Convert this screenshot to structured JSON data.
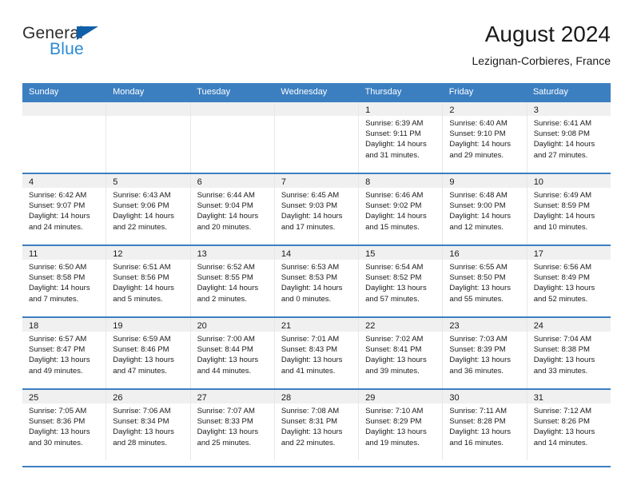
{
  "brand": {
    "name_part1": "General",
    "name_part2": "Blue",
    "triangle_icon": "blue-triangle-icon",
    "colors": {
      "dark": "#2e2e2e",
      "blue": "#2a8ad4",
      "triangle": "#1060a8"
    }
  },
  "header": {
    "title": "August 2024",
    "subtitle": "Lezignan-Corbieres, France"
  },
  "theme": {
    "header_bg": "#3c7fc1",
    "header_text": "#ffffff",
    "daynum_band": "#f0f0f0",
    "row_separator": "#3c7fc1",
    "column_separator": "#e7e7e7"
  },
  "weekday_headers": [
    "Sunday",
    "Monday",
    "Tuesday",
    "Wednesday",
    "Thursday",
    "Friday",
    "Saturday"
  ],
  "weeks": [
    [
      {
        "day": "",
        "sunrise": "",
        "sunset": "",
        "daylight_a": "",
        "daylight_b": ""
      },
      {
        "day": "",
        "sunrise": "",
        "sunset": "",
        "daylight_a": "",
        "daylight_b": ""
      },
      {
        "day": "",
        "sunrise": "",
        "sunset": "",
        "daylight_a": "",
        "daylight_b": ""
      },
      {
        "day": "",
        "sunrise": "",
        "sunset": "",
        "daylight_a": "",
        "daylight_b": ""
      },
      {
        "day": "1",
        "sunrise": "Sunrise: 6:39 AM",
        "sunset": "Sunset: 9:11 PM",
        "daylight_a": "Daylight: 14 hours",
        "daylight_b": "and 31 minutes."
      },
      {
        "day": "2",
        "sunrise": "Sunrise: 6:40 AM",
        "sunset": "Sunset: 9:10 PM",
        "daylight_a": "Daylight: 14 hours",
        "daylight_b": "and 29 minutes."
      },
      {
        "day": "3",
        "sunrise": "Sunrise: 6:41 AM",
        "sunset": "Sunset: 9:08 PM",
        "daylight_a": "Daylight: 14 hours",
        "daylight_b": "and 27 minutes."
      }
    ],
    [
      {
        "day": "4",
        "sunrise": "Sunrise: 6:42 AM",
        "sunset": "Sunset: 9:07 PM",
        "daylight_a": "Daylight: 14 hours",
        "daylight_b": "and 24 minutes."
      },
      {
        "day": "5",
        "sunrise": "Sunrise: 6:43 AM",
        "sunset": "Sunset: 9:06 PM",
        "daylight_a": "Daylight: 14 hours",
        "daylight_b": "and 22 minutes."
      },
      {
        "day": "6",
        "sunrise": "Sunrise: 6:44 AM",
        "sunset": "Sunset: 9:04 PM",
        "daylight_a": "Daylight: 14 hours",
        "daylight_b": "and 20 minutes."
      },
      {
        "day": "7",
        "sunrise": "Sunrise: 6:45 AM",
        "sunset": "Sunset: 9:03 PM",
        "daylight_a": "Daylight: 14 hours",
        "daylight_b": "and 17 minutes."
      },
      {
        "day": "8",
        "sunrise": "Sunrise: 6:46 AM",
        "sunset": "Sunset: 9:02 PM",
        "daylight_a": "Daylight: 14 hours",
        "daylight_b": "and 15 minutes."
      },
      {
        "day": "9",
        "sunrise": "Sunrise: 6:48 AM",
        "sunset": "Sunset: 9:00 PM",
        "daylight_a": "Daylight: 14 hours",
        "daylight_b": "and 12 minutes."
      },
      {
        "day": "10",
        "sunrise": "Sunrise: 6:49 AM",
        "sunset": "Sunset: 8:59 PM",
        "daylight_a": "Daylight: 14 hours",
        "daylight_b": "and 10 minutes."
      }
    ],
    [
      {
        "day": "11",
        "sunrise": "Sunrise: 6:50 AM",
        "sunset": "Sunset: 8:58 PM",
        "daylight_a": "Daylight: 14 hours",
        "daylight_b": "and 7 minutes."
      },
      {
        "day": "12",
        "sunrise": "Sunrise: 6:51 AM",
        "sunset": "Sunset: 8:56 PM",
        "daylight_a": "Daylight: 14 hours",
        "daylight_b": "and 5 minutes."
      },
      {
        "day": "13",
        "sunrise": "Sunrise: 6:52 AM",
        "sunset": "Sunset: 8:55 PM",
        "daylight_a": "Daylight: 14 hours",
        "daylight_b": "and 2 minutes."
      },
      {
        "day": "14",
        "sunrise": "Sunrise: 6:53 AM",
        "sunset": "Sunset: 8:53 PM",
        "daylight_a": "Daylight: 14 hours",
        "daylight_b": "and 0 minutes."
      },
      {
        "day": "15",
        "sunrise": "Sunrise: 6:54 AM",
        "sunset": "Sunset: 8:52 PM",
        "daylight_a": "Daylight: 13 hours",
        "daylight_b": "and 57 minutes."
      },
      {
        "day": "16",
        "sunrise": "Sunrise: 6:55 AM",
        "sunset": "Sunset: 8:50 PM",
        "daylight_a": "Daylight: 13 hours",
        "daylight_b": "and 55 minutes."
      },
      {
        "day": "17",
        "sunrise": "Sunrise: 6:56 AM",
        "sunset": "Sunset: 8:49 PM",
        "daylight_a": "Daylight: 13 hours",
        "daylight_b": "and 52 minutes."
      }
    ],
    [
      {
        "day": "18",
        "sunrise": "Sunrise: 6:57 AM",
        "sunset": "Sunset: 8:47 PM",
        "daylight_a": "Daylight: 13 hours",
        "daylight_b": "and 49 minutes."
      },
      {
        "day": "19",
        "sunrise": "Sunrise: 6:59 AM",
        "sunset": "Sunset: 8:46 PM",
        "daylight_a": "Daylight: 13 hours",
        "daylight_b": "and 47 minutes."
      },
      {
        "day": "20",
        "sunrise": "Sunrise: 7:00 AM",
        "sunset": "Sunset: 8:44 PM",
        "daylight_a": "Daylight: 13 hours",
        "daylight_b": "and 44 minutes."
      },
      {
        "day": "21",
        "sunrise": "Sunrise: 7:01 AM",
        "sunset": "Sunset: 8:43 PM",
        "daylight_a": "Daylight: 13 hours",
        "daylight_b": "and 41 minutes."
      },
      {
        "day": "22",
        "sunrise": "Sunrise: 7:02 AM",
        "sunset": "Sunset: 8:41 PM",
        "daylight_a": "Daylight: 13 hours",
        "daylight_b": "and 39 minutes."
      },
      {
        "day": "23",
        "sunrise": "Sunrise: 7:03 AM",
        "sunset": "Sunset: 8:39 PM",
        "daylight_a": "Daylight: 13 hours",
        "daylight_b": "and 36 minutes."
      },
      {
        "day": "24",
        "sunrise": "Sunrise: 7:04 AM",
        "sunset": "Sunset: 8:38 PM",
        "daylight_a": "Daylight: 13 hours",
        "daylight_b": "and 33 minutes."
      }
    ],
    [
      {
        "day": "25",
        "sunrise": "Sunrise: 7:05 AM",
        "sunset": "Sunset: 8:36 PM",
        "daylight_a": "Daylight: 13 hours",
        "daylight_b": "and 30 minutes."
      },
      {
        "day": "26",
        "sunrise": "Sunrise: 7:06 AM",
        "sunset": "Sunset: 8:34 PM",
        "daylight_a": "Daylight: 13 hours",
        "daylight_b": "and 28 minutes."
      },
      {
        "day": "27",
        "sunrise": "Sunrise: 7:07 AM",
        "sunset": "Sunset: 8:33 PM",
        "daylight_a": "Daylight: 13 hours",
        "daylight_b": "and 25 minutes."
      },
      {
        "day": "28",
        "sunrise": "Sunrise: 7:08 AM",
        "sunset": "Sunset: 8:31 PM",
        "daylight_a": "Daylight: 13 hours",
        "daylight_b": "and 22 minutes."
      },
      {
        "day": "29",
        "sunrise": "Sunrise: 7:10 AM",
        "sunset": "Sunset: 8:29 PM",
        "daylight_a": "Daylight: 13 hours",
        "daylight_b": "and 19 minutes."
      },
      {
        "day": "30",
        "sunrise": "Sunrise: 7:11 AM",
        "sunset": "Sunset: 8:28 PM",
        "daylight_a": "Daylight: 13 hours",
        "daylight_b": "and 16 minutes."
      },
      {
        "day": "31",
        "sunrise": "Sunrise: 7:12 AM",
        "sunset": "Sunset: 8:26 PM",
        "daylight_a": "Daylight: 13 hours",
        "daylight_b": "and 14 minutes."
      }
    ]
  ]
}
